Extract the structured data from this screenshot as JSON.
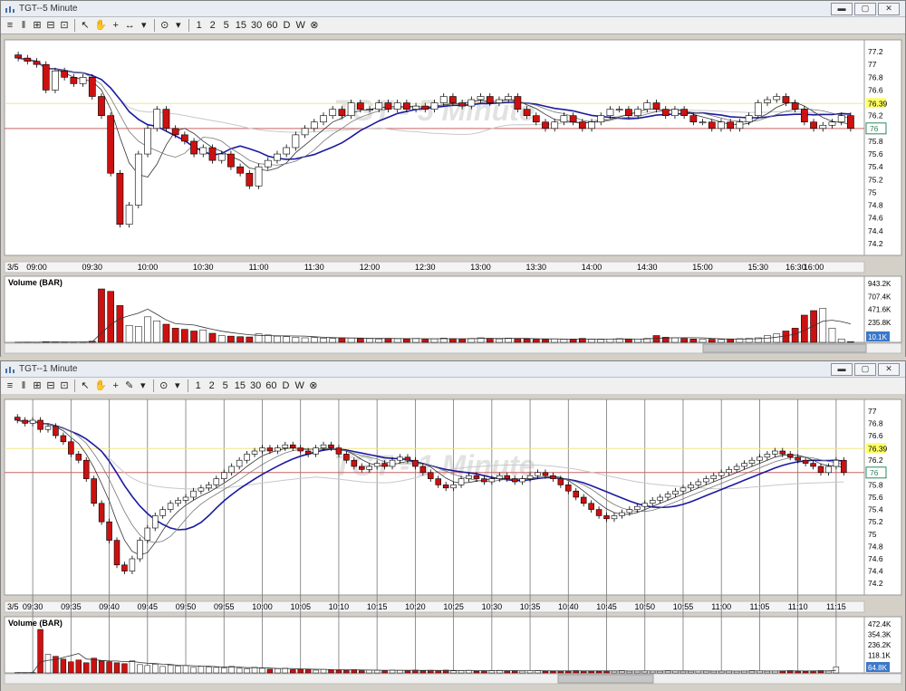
{
  "windows": [
    {
      "title": "TGT--5 Minute",
      "watermark": "TGT - 5 Minute",
      "toolbar": [
        "≡",
        "‖",
        "⊞",
        "⊟",
        "⊡",
        "↖",
        "✋",
        "+",
        "↔",
        "▾",
        "⊙",
        "▾",
        "1",
        "2",
        "5",
        "15",
        "30",
        "60",
        "D",
        "W",
        "⊗"
      ],
      "price_labels": [
        "77.2",
        "77",
        "76.8",
        "76.6",
        "76.39",
        "76.2",
        "76",
        "75.8",
        "75.6",
        "75.4",
        "75.2",
        "75",
        "74.8",
        "74.6",
        "74.4",
        "74.2"
      ],
      "last_price": "76",
      "yellow_label": "76.39",
      "date_label": "3/5",
      "time_labels": [
        "09:00",
        "09:30",
        "10:00",
        "10:30",
        "11:00",
        "11:30",
        "12:00",
        "12:30",
        "13:00",
        "13:30",
        "14:00",
        "14:30",
        "15:00",
        "15:30",
        "16:00",
        "16:30"
      ],
      "volume_title": "Volume (BAR)",
      "volume_labels": [
        "943.2K",
        "707.4K",
        "471.6K",
        "235.8K"
      ],
      "volume_last": "10.1K"
    },
    {
      "title": "TGT--1 Minute",
      "watermark": "TGT - 1 Minute",
      "toolbar": [
        "≡",
        "‖",
        "⊞",
        "⊟",
        "⊡",
        "↖",
        "✋",
        "+",
        "✎",
        "▾",
        "⊙",
        "▾",
        "1",
        "2",
        "5",
        "15",
        "30",
        "60",
        "D",
        "W",
        "⊗"
      ],
      "price_labels": [
        "77",
        "76.8",
        "76.6",
        "76.39",
        "76.2",
        "76",
        "75.8",
        "75.6",
        "75.4",
        "75.2",
        "75",
        "74.8",
        "74.6",
        "74.4",
        "74.2"
      ],
      "last_price": "76",
      "yellow_label": "76.39",
      "date_label": "3/5",
      "time_labels": [
        "09:30",
        "09:35",
        "09:40",
        "09:45",
        "09:50",
        "09:55",
        "10:00",
        "10:05",
        "10:10",
        "10:15",
        "10:20",
        "10:25",
        "10:30",
        "10:35",
        "10:40",
        "10:45",
        "10:50",
        "10:55",
        "11:00",
        "11:05",
        "11:10",
        "11:15"
      ],
      "volume_title": "Volume (BAR)",
      "volume_labels": [
        "472.4K",
        "354.3K",
        "236.2K",
        "118.1K"
      ],
      "volume_last": "64.8K"
    }
  ],
  "chart_data": [
    {
      "type": "candlestick",
      "title": "TGT--5 Minute",
      "xlabel": "",
      "ylabel": "",
      "ylim": [
        74.1,
        77.3
      ],
      "reference_lines": {
        "yellow": 76.39,
        "red": 76.0
      },
      "x": [
        "08:50",
        "08:55",
        "09:00",
        "09:05",
        "09:10",
        "09:15",
        "09:20",
        "09:25",
        "09:30",
        "09:35",
        "09:40",
        "09:45",
        "09:50",
        "09:55",
        "10:00",
        "10:05",
        "10:10",
        "10:15",
        "10:20",
        "10:25",
        "10:30",
        "10:35",
        "10:40",
        "10:45",
        "10:50",
        "10:55",
        "11:00",
        "11:05",
        "11:10",
        "11:15",
        "11:20",
        "11:25",
        "11:30",
        "11:35",
        "11:40",
        "11:45",
        "11:50",
        "11:55",
        "12:00",
        "12:05",
        "12:10",
        "12:15",
        "12:20",
        "12:25",
        "12:30",
        "12:35",
        "12:40",
        "12:45",
        "12:50",
        "12:55",
        "13:00",
        "13:05",
        "13:10",
        "13:15",
        "13:20",
        "13:25",
        "13:30",
        "13:35",
        "13:40",
        "13:45",
        "13:50",
        "13:55",
        "14:00",
        "14:05",
        "14:10",
        "14:15",
        "14:20",
        "14:25",
        "14:30",
        "14:35",
        "14:40",
        "14:45",
        "14:50",
        "14:55",
        "15:00",
        "15:05",
        "15:10",
        "15:15",
        "15:20",
        "15:25",
        "15:30",
        "15:35",
        "15:40",
        "15:45",
        "15:50",
        "15:55",
        "16:00",
        "16:05",
        "16:10",
        "16:15",
        "16:20"
      ],
      "series": [
        {
          "name": "price",
          "close": [
            77.1,
            77.05,
            77.0,
            76.6,
            76.9,
            76.8,
            76.7,
            76.8,
            76.5,
            76.2,
            75.3,
            74.5,
            74.8,
            75.6,
            76.0,
            76.3,
            76.0,
            75.9,
            75.8,
            75.6,
            75.7,
            75.5,
            75.6,
            75.4,
            75.3,
            75.1,
            75.4,
            75.5,
            75.6,
            75.7,
            75.9,
            76.0,
            76.1,
            76.2,
            76.3,
            76.2,
            76.4,
            76.3,
            76.3,
            76.4,
            76.3,
            76.4,
            76.3,
            76.35,
            76.3,
            76.4,
            76.5,
            76.4,
            76.35,
            76.45,
            76.5,
            76.4,
            76.45,
            76.5,
            76.3,
            76.2,
            76.1,
            76.0,
            76.1,
            76.2,
            76.1,
            76.0,
            76.1,
            76.2,
            76.3,
            76.3,
            76.2,
            76.3,
            76.4,
            76.3,
            76.2,
            76.3,
            76.2,
            76.1,
            76.1,
            76.0,
            76.1,
            76.0,
            76.1,
            76.2,
            76.4,
            76.45,
            76.5,
            76.4,
            76.3,
            76.1,
            76.0,
            76.05,
            76.1,
            76.2,
            76.0
          ]
        },
        {
          "name": "volume",
          "values": [
            2,
            3,
            2,
            12,
            8,
            6,
            4,
            5,
            20,
            943,
            900,
            650,
            300,
            280,
            450,
            380,
            320,
            250,
            230,
            200,
            220,
            160,
            120,
            110,
            100,
            95,
            150,
            130,
            110,
            100,
            90,
            80,
            85,
            75,
            70,
            80,
            75,
            70,
            65,
            60,
            70,
            65,
            60,
            70,
            55,
            60,
            75,
            65,
            60,
            70,
            80,
            70,
            60,
            75,
            65,
            60,
            55,
            50,
            60,
            55,
            60,
            70,
            55,
            50,
            60,
            65,
            55,
            60,
            70,
            120,
            90,
            80,
            70,
            60,
            60,
            55,
            50,
            60,
            65,
            70,
            80,
            120,
            150,
            200,
            250,
            480,
            560,
            600,
            250,
            60,
            10
          ]
        }
      ]
    },
    {
      "type": "candlestick",
      "title": "TGT--1 Minute",
      "xlabel": "",
      "ylabel": "",
      "ylim": [
        74.1,
        77.1
      ],
      "reference_lines": {
        "yellow": 76.39,
        "red": 76.0
      },
      "x": [
        "09:28",
        "09:29",
        "09:30",
        "09:31",
        "09:32",
        "09:33",
        "09:34",
        "09:35",
        "09:36",
        "09:37",
        "09:38",
        "09:39",
        "09:40",
        "09:41",
        "09:42",
        "09:43",
        "09:44",
        "09:45",
        "09:46",
        "09:47",
        "09:48",
        "09:49",
        "09:50",
        "09:51",
        "09:52",
        "09:53",
        "09:54",
        "09:55",
        "09:56",
        "09:57",
        "09:58",
        "09:59",
        "10:00",
        "10:01",
        "10:02",
        "10:03",
        "10:04",
        "10:05",
        "10:06",
        "10:07",
        "10:08",
        "10:09",
        "10:10",
        "10:11",
        "10:12",
        "10:13",
        "10:14",
        "10:15",
        "10:16",
        "10:17",
        "10:18",
        "10:19",
        "10:20",
        "10:21",
        "10:22",
        "10:23",
        "10:24",
        "10:25",
        "10:26",
        "10:27",
        "10:28",
        "10:29",
        "10:30",
        "10:31",
        "10:32",
        "10:33",
        "10:34",
        "10:35",
        "10:36",
        "10:37",
        "10:38",
        "10:39",
        "10:40",
        "10:41",
        "10:42",
        "10:43",
        "10:44",
        "10:45",
        "10:46",
        "10:47",
        "10:48",
        "10:49",
        "10:50",
        "10:51",
        "10:52",
        "10:53",
        "10:54",
        "10:55",
        "10:56",
        "10:57",
        "10:58",
        "10:59",
        "11:00",
        "11:01",
        "11:02",
        "11:03",
        "11:04",
        "11:05",
        "11:06",
        "11:07",
        "11:08",
        "11:09",
        "11:10",
        "11:11",
        "11:12",
        "11:13",
        "11:14",
        "11:15",
        "11:16",
        "11:17"
      ],
      "series": [
        {
          "name": "price",
          "close": [
            76.85,
            76.8,
            76.85,
            76.7,
            76.75,
            76.6,
            76.5,
            76.3,
            76.2,
            75.9,
            75.5,
            75.2,
            74.9,
            74.5,
            74.4,
            74.6,
            74.9,
            75.1,
            75.3,
            75.4,
            75.5,
            75.55,
            75.6,
            75.7,
            75.75,
            75.8,
            75.9,
            76.0,
            76.1,
            76.2,
            76.3,
            76.35,
            76.4,
            76.35,
            76.4,
            76.45,
            76.4,
            76.35,
            76.3,
            76.4,
            76.45,
            76.4,
            76.3,
            76.2,
            76.1,
            76.05,
            76.1,
            76.15,
            76.1,
            76.2,
            76.25,
            76.2,
            76.1,
            76.0,
            75.9,
            75.8,
            75.75,
            75.8,
            75.9,
            75.95,
            75.9,
            75.85,
            75.9,
            75.95,
            75.9,
            75.85,
            75.9,
            75.95,
            76.0,
            75.95,
            75.9,
            75.8,
            75.7,
            75.6,
            75.5,
            75.4,
            75.3,
            75.25,
            75.3,
            75.35,
            75.4,
            75.45,
            75.5,
            75.55,
            75.6,
            75.65,
            75.7,
            75.75,
            75.8,
            75.85,
            75.9,
            75.95,
            76.0,
            76.05,
            76.1,
            76.15,
            76.2,
            76.25,
            76.3,
            76.35,
            76.3,
            76.25,
            76.2,
            76.15,
            76.1,
            76.0,
            76.1,
            76.2,
            76.0
          ]
        },
        {
          "name": "volume",
          "values": [
            3,
            2,
            4,
            472,
            200,
            180,
            150,
            120,
            140,
            110,
            160,
            130,
            120,
            110,
            100,
            130,
            90,
            80,
            95,
            70,
            85,
            75,
            80,
            60,
            70,
            65,
            60,
            55,
            70,
            50,
            45,
            60,
            50,
            40,
            45,
            50,
            35,
            40,
            35,
            30,
            38,
            32,
            30,
            28,
            35,
            25,
            30,
            28,
            25,
            30,
            28,
            25,
            30,
            22,
            28,
            25,
            30,
            22,
            25,
            28,
            20,
            22,
            25,
            28,
            22,
            25,
            20,
            22,
            25,
            20,
            18,
            22,
            20,
            25,
            22,
            20,
            18,
            22,
            20,
            25,
            18,
            20,
            22,
            20,
            18,
            25,
            22,
            20,
            18,
            22,
            20,
            18,
            20,
            22,
            18,
            20,
            25,
            22,
            18,
            20,
            22,
            25,
            20,
            18,
            22,
            25,
            20,
            65
          ]
        }
      ]
    }
  ]
}
